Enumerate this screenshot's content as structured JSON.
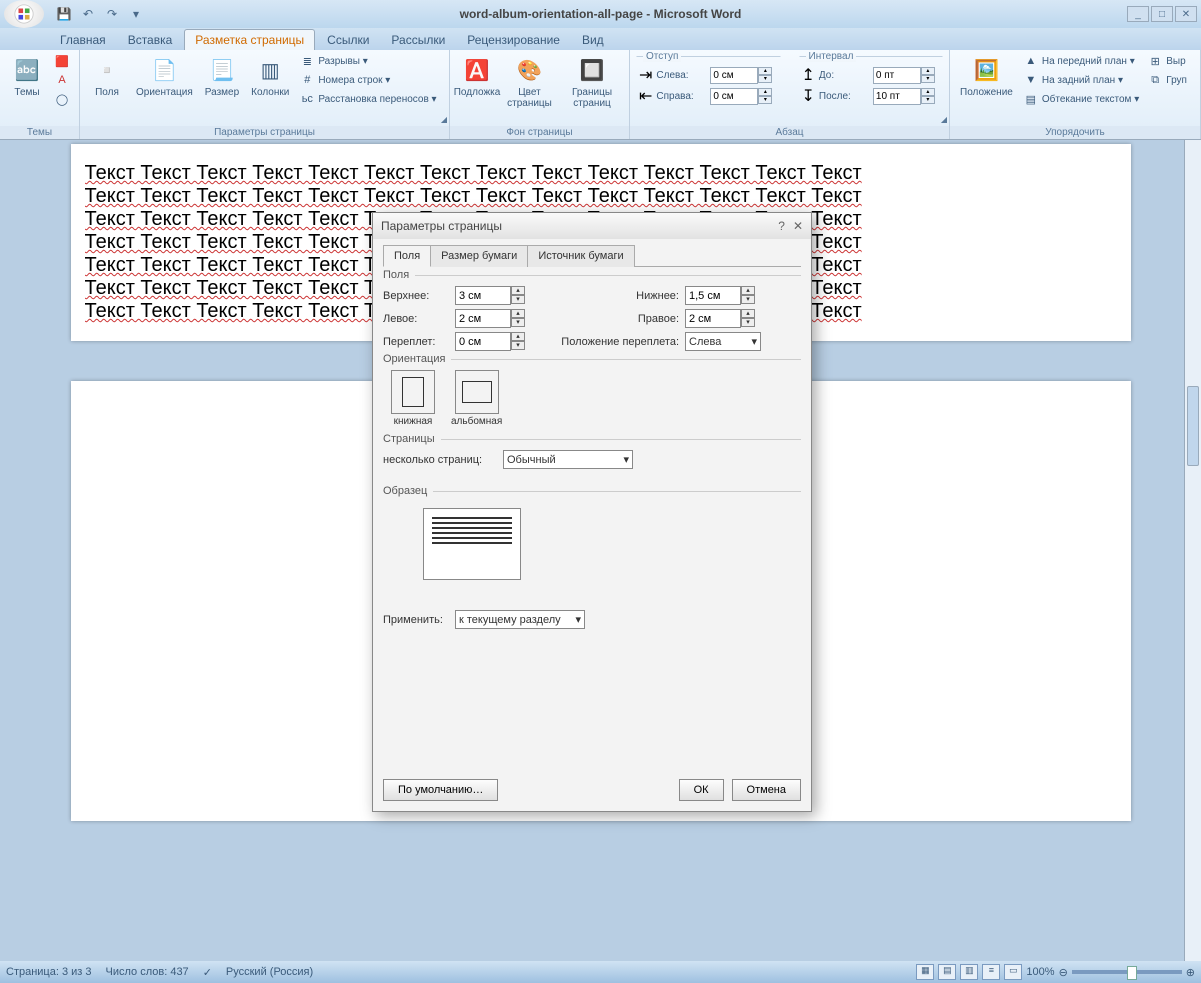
{
  "window": {
    "title": "word-album-orientation-all-page  -  Microsoft Word"
  },
  "qat": {
    "undo": "↶",
    "redo": "↷",
    "save": "💾"
  },
  "tabs": [
    "Главная",
    "Вставка",
    "Разметка страницы",
    "Ссылки",
    "Рассылки",
    "Рецензирование",
    "Вид"
  ],
  "active_tab_index": 2,
  "ribbon": {
    "themes": {
      "label": "Темы",
      "btn": "Темы"
    },
    "page_setup": {
      "label": "Параметры страницы",
      "margins": "Поля",
      "orientation": "Ориентация",
      "size": "Размер",
      "columns": "Колонки",
      "breaks": "Разрывы ▾",
      "line_numbers": "Номера строк ▾",
      "hyphenation": "Расстановка переносов ▾"
    },
    "page_bg": {
      "label": "Фон страницы",
      "watermark": "Подложка",
      "color": "Цвет страницы",
      "borders": "Границы страниц"
    },
    "paragraph": {
      "label": "Абзац",
      "indent_group": "Отступ",
      "spacing_group": "Интервал",
      "left_lbl": "Слева:",
      "left_val": "0 см",
      "right_lbl": "Справа:",
      "right_val": "0 см",
      "before_lbl": "До:",
      "before_val": "0 пт",
      "after_lbl": "После:",
      "after_val": "10 пт"
    },
    "arrange": {
      "label": "Упорядочить",
      "position": "Положение",
      "front": "На передний план ▾",
      "back": "На задний план ▾",
      "wrap": "Обтекание текстом ▾",
      "align": "Выр",
      "group": "Груп"
    }
  },
  "doc": {
    "word": "Текст",
    "repeat_per_line": 14,
    "lines": 7
  },
  "dialog": {
    "title": "Параметры страницы",
    "tabs": [
      "Поля",
      "Размер бумаги",
      "Источник бумаги"
    ],
    "active_tab": 0,
    "margins_head": "Поля",
    "top_lbl": "Верхнее:",
    "top_val": "3 см",
    "bottom_lbl": "Нижнее:",
    "bottom_val": "1,5 см",
    "left_lbl": "Левое:",
    "left_val": "2 см",
    "right_lbl": "Правое:",
    "right_val": "2 см",
    "gutter_lbl": "Переплет:",
    "gutter_val": "0 см",
    "gutter_pos_lbl": "Положение переплета:",
    "gutter_pos_val": "Слева",
    "orient_head": "Ориентация",
    "portrait": "книжная",
    "landscape": "альбомная",
    "pages_head": "Страницы",
    "multi_lbl": "несколько страниц:",
    "multi_val": "Обычный",
    "preview_head": "Образец",
    "apply_lbl": "Применить:",
    "apply_val": "к текущему разделу",
    "default_btn": "По умолчанию…",
    "ok": "ОК",
    "cancel": "Отмена"
  },
  "statusbar": {
    "page": "Страница: 3 из 3",
    "words": "Число слов: 437",
    "lang": "Русский (Россия)",
    "zoom": "100%"
  }
}
